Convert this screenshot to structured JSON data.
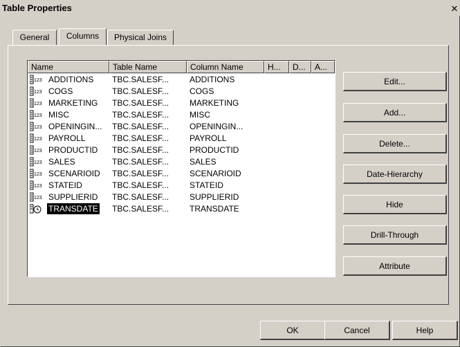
{
  "window": {
    "title": "Table Properties",
    "close_glyph": "✕"
  },
  "tabs": [
    {
      "label": "General"
    },
    {
      "label": "Columns"
    },
    {
      "label": "Physical Joins"
    }
  ],
  "active_tab": "Columns",
  "list": {
    "headers": [
      "Name",
      "Table Name",
      "Column Name",
      "H...",
      "D...",
      "A..."
    ],
    "rows": [
      {
        "name": "ADDITIONS",
        "table": "TBC.SALESF...",
        "column": "ADDITIONS",
        "icon": "numeric-column-icon"
      },
      {
        "name": "COGS",
        "table": "TBC.SALESF...",
        "column": "COGS",
        "icon": "numeric-column-icon"
      },
      {
        "name": "MARKETING",
        "table": "TBC.SALESF...",
        "column": "MARKETING",
        "icon": "numeric-column-icon"
      },
      {
        "name": "MISC",
        "table": "TBC.SALESF...",
        "column": "MISC",
        "icon": "numeric-column-icon"
      },
      {
        "name": "OPENINGIN...",
        "table": "TBC.SALESF...",
        "column": "OPENINGIN...",
        "icon": "numeric-column-icon"
      },
      {
        "name": "PAYROLL",
        "table": "TBC.SALESF...",
        "column": "PAYROLL",
        "icon": "numeric-column-icon"
      },
      {
        "name": "PRODUCTID",
        "table": "TBC.SALESF...",
        "column": "PRODUCTID",
        "icon": "numeric-column-icon"
      },
      {
        "name": "SALES",
        "table": "TBC.SALESF...",
        "column": "SALES",
        "icon": "numeric-column-icon"
      },
      {
        "name": "SCENARIOID",
        "table": "TBC.SALESF...",
        "column": "SCENARIOID",
        "icon": "numeric-column-icon"
      },
      {
        "name": "STATEID",
        "table": "TBC.SALESF...",
        "column": "STATEID",
        "icon": "numeric-column-icon"
      },
      {
        "name": "SUPPLIERID",
        "table": "TBC.SALESF...",
        "column": "SUPPLIERID",
        "icon": "numeric-column-icon"
      },
      {
        "name": "TRANSDATE",
        "table": "TBC.SALESF...",
        "column": "TRANSDATE",
        "icon": "date-column-icon",
        "selected": true
      }
    ]
  },
  "side_buttons": [
    {
      "label": "Edit...",
      "name": "edit-button"
    },
    {
      "label": "Add...",
      "name": "add-button"
    },
    {
      "label": "Delete...",
      "name": "delete-button"
    },
    {
      "label": "Date-Hierarchy",
      "name": "date-hierarchy-button"
    },
    {
      "label": "Hide",
      "name": "hide-button"
    },
    {
      "label": "Drill-Through",
      "name": "drill-through-button"
    },
    {
      "label": "Attribute",
      "name": "attribute-button"
    }
  ],
  "bottom_buttons": [
    {
      "label": "OK",
      "name": "ok-button"
    },
    {
      "label": "Cancel",
      "name": "cancel-button"
    },
    {
      "label": "Help",
      "name": "help-button"
    }
  ],
  "icon_glyphs": {
    "numeric_subscript": "123"
  }
}
